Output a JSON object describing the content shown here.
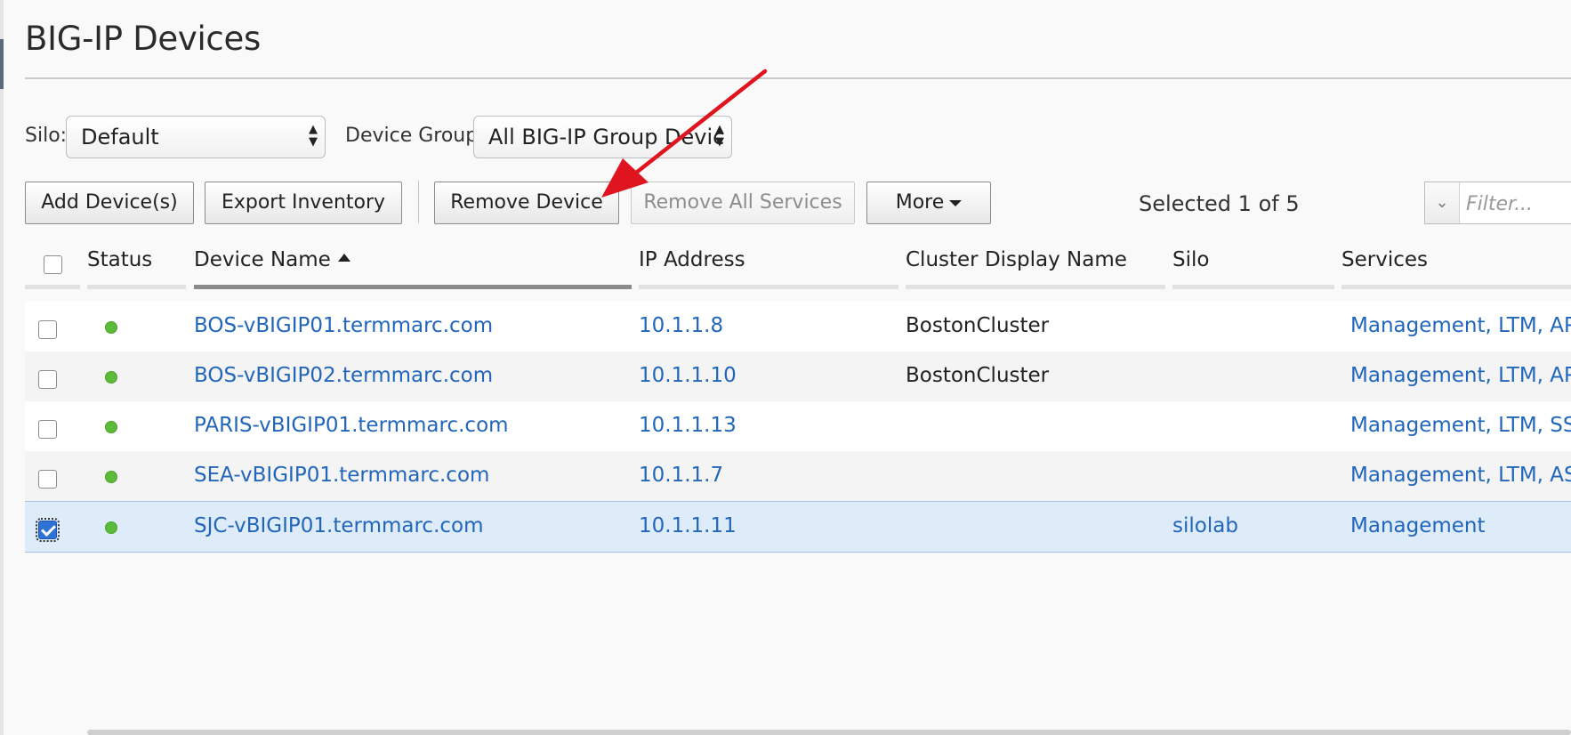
{
  "page": {
    "title": "BIG-IP Devices"
  },
  "filters": {
    "silo_label": "Silo:",
    "silo_value": "Default",
    "device_group_label": "Device Group:",
    "device_group_value": "All BIG-IP Group Devic"
  },
  "toolbar": {
    "add_label": "Add Device(s)",
    "export_label": "Export Inventory",
    "remove_label": "Remove Device",
    "remove_services_label": "Remove All Services",
    "more_label": "More",
    "selected_text": "Selected 1 of 5",
    "filter_placeholder": "Filter..."
  },
  "table": {
    "headers": {
      "status": "Status",
      "device_name": "Device Name",
      "ip": "IP Address",
      "cluster": "Cluster Display Name",
      "silo": "Silo",
      "services": "Services"
    },
    "rows": [
      {
        "status": "online",
        "name": "BOS-vBIGIP01.termmarc.com",
        "ip": "10.1.1.8",
        "cluster": "BostonCluster",
        "silo": "",
        "services": "Management, LTM, AP",
        "selected": false
      },
      {
        "status": "online",
        "name": "BOS-vBIGIP02.termmarc.com",
        "ip": "10.1.1.10",
        "cluster": "BostonCluster",
        "silo": "",
        "services": "Management, LTM, AP",
        "selected": false
      },
      {
        "status": "online",
        "name": "PARIS-vBIGIP01.termmarc.com",
        "ip": "10.1.1.13",
        "cluster": "",
        "silo": "",
        "services": "Management, LTM, SS",
        "selected": false
      },
      {
        "status": "online",
        "name": "SEA-vBIGIP01.termmarc.com",
        "ip": "10.1.1.7",
        "cluster": "",
        "silo": "",
        "services": "Management, LTM, AS",
        "selected": false
      },
      {
        "status": "online",
        "name": "SJC-vBIGIP01.termmarc.com",
        "ip": "10.1.1.11",
        "cluster": "",
        "silo": "silolab",
        "services": "Management",
        "selected": true
      }
    ]
  },
  "colors": {
    "link": "#2266bb",
    "status_online": "#5dbb3c",
    "selected_row": "#deebf9",
    "annotation_arrow": "#e0141e"
  },
  "icons": {
    "select_arrows": "up-down-arrows-icon",
    "more_caret": "caret-down-icon",
    "sort": "sort-ascending-icon",
    "filter_dropdown": "chevron-down-icon",
    "status": "status-dot-icon",
    "annotation": "red-arrow-annotation"
  }
}
